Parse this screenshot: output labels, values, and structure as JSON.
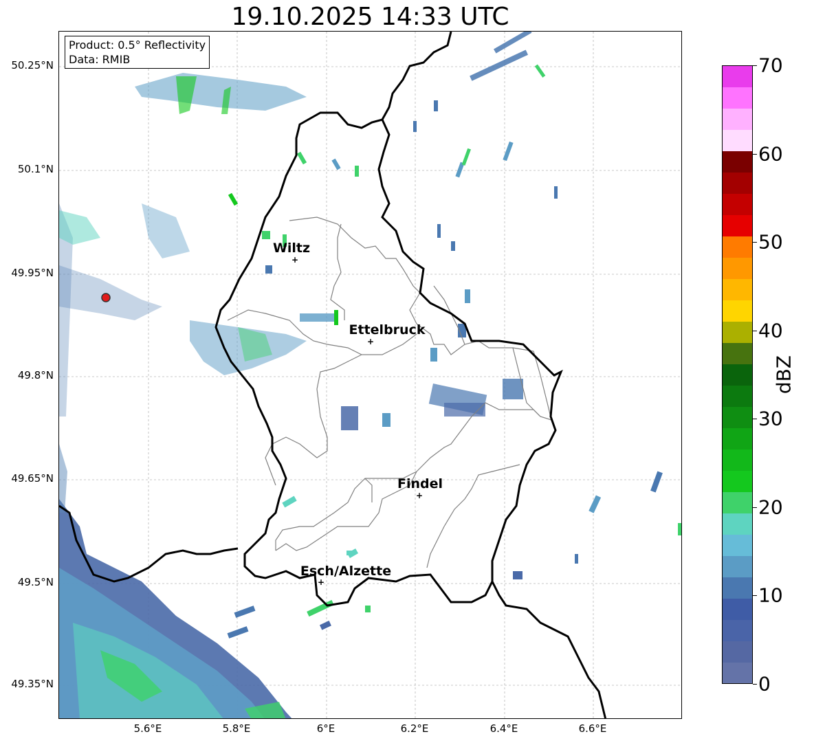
{
  "title": "19.10.2025 14:33 UTC",
  "info": {
    "product": "Product: 0.5° Reflectivity",
    "data": "Data: RMIB"
  },
  "axes": {
    "lat_labels": [
      "50.25°N",
      "50.1°N",
      "49.95°N",
      "49.8°N",
      "49.65°N",
      "49.5°N",
      "49.35°N"
    ],
    "lon_labels": [
      "5.6°E",
      "5.8°E",
      "6°E",
      "6.2°E",
      "6.4°E",
      "6.6°E"
    ]
  },
  "cities": [
    {
      "name": "Wiltz"
    },
    {
      "name": "Ettelbruck"
    },
    {
      "name": "Findel"
    },
    {
      "name": "Esch/Alzette"
    }
  ],
  "colorbar": {
    "label": "dBZ",
    "ticks": [
      "0",
      "10",
      "20",
      "30",
      "40",
      "50",
      "60",
      "70"
    ],
    "colors": [
      "#6473a8",
      "#5568a3",
      "#4a64a8",
      "#3f5ca6",
      "#4a78b0",
      "#5b9cc5",
      "#66bcd8",
      "#5ed4c0",
      "#3fd26a",
      "#14c81e",
      "#12b81a",
      "#10a515",
      "#0f8e12",
      "#0c7a0f",
      "#0a640c",
      "#47730f",
      "#abb000",
      "#ffd500",
      "#ffb700",
      "#ff9800",
      "#ff7b00",
      "#e60000",
      "#c40000",
      "#a30000",
      "#7a0000",
      "#ffdcff",
      "#ffb1ff",
      "#ff73ff",
      "#e93cec"
    ]
  },
  "colors": {
    "radar_station": "#e11b1b",
    "border": "#000000",
    "district": "#808080"
  }
}
